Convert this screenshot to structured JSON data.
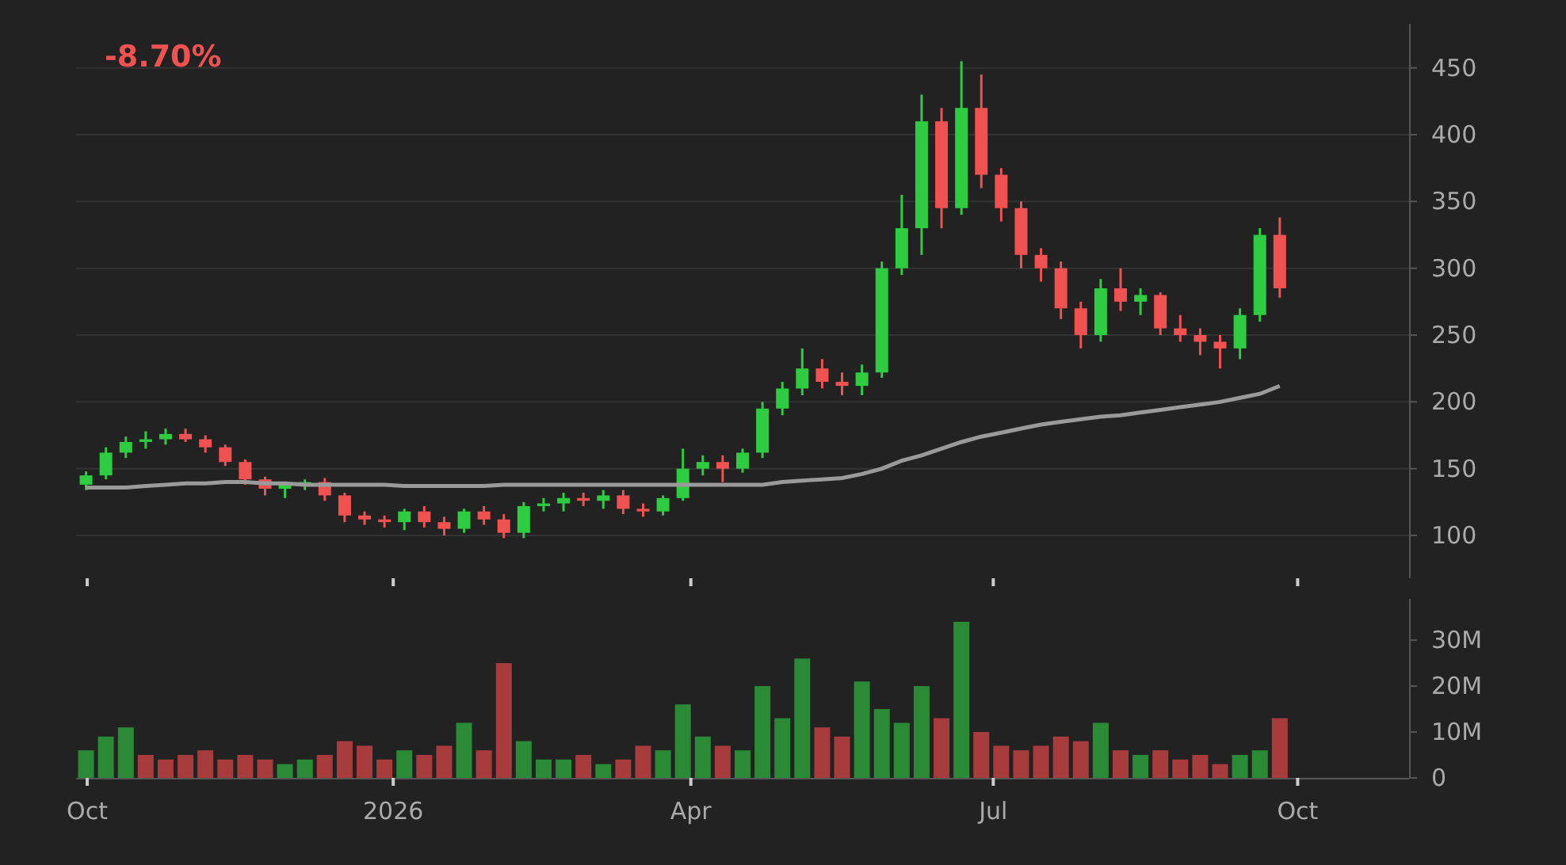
{
  "change": {
    "text": "-8.70%"
  },
  "price_panel": {
    "chart_data": {
      "type": "candlestick",
      "categories": [
        null,
        null,
        null,
        null,
        null,
        null,
        null,
        null,
        null,
        null,
        null,
        null,
        null,
        null,
        null,
        null,
        null,
        null,
        null,
        null,
        null,
        null,
        null,
        null,
        null,
        null,
        null,
        null,
        null,
        null,
        null,
        null,
        null,
        null,
        null,
        null,
        null,
        null,
        null,
        null,
        null,
        null,
        null,
        null,
        null,
        null,
        null,
        null,
        null,
        null,
        null,
        null,
        null,
        null,
        null,
        null,
        null,
        null,
        null,
        null,
        null,
        null,
        null,
        null,
        null,
        null,
        null
      ],
      "ohlc": [
        [
          138,
          148,
          134,
          145
        ],
        [
          145,
          166,
          142,
          162
        ],
        [
          162,
          174,
          158,
          170
        ],
        [
          170,
          178,
          165,
          172
        ],
        [
          172,
          180,
          168,
          176
        ],
        [
          176,
          180,
          170,
          172
        ],
        [
          172,
          175,
          162,
          166
        ],
        [
          166,
          168,
          152,
          155
        ],
        [
          155,
          157,
          138,
          142
        ],
        [
          142,
          144,
          130,
          135
        ],
        [
          135,
          140,
          128,
          138
        ],
        [
          138,
          142,
          134,
          140
        ],
        [
          140,
          143,
          126,
          130
        ],
        [
          130,
          132,
          110,
          115
        ],
        [
          115,
          118,
          108,
          112
        ],
        [
          112,
          115,
          106,
          110
        ],
        [
          110,
          120,
          104,
          118
        ],
        [
          118,
          122,
          106,
          110
        ],
        [
          110,
          114,
          100,
          105
        ],
        [
          105,
          120,
          102,
          118
        ],
        [
          118,
          122,
          108,
          112
        ],
        [
          112,
          116,
          98,
          102
        ],
        [
          102,
          125,
          98,
          122
        ],
        [
          122,
          128,
          118,
          124
        ],
        [
          124,
          132,
          118,
          128
        ],
        [
          128,
          132,
          122,
          126
        ],
        [
          126,
          134,
          120,
          130
        ],
        [
          130,
          134,
          116,
          120
        ],
        [
          120,
          124,
          114,
          118
        ],
        [
          118,
          130,
          115,
          128
        ],
        [
          128,
          165,
          126,
          150
        ],
        [
          150,
          160,
          145,
          155
        ],
        [
          155,
          160,
          140,
          150
        ],
        [
          150,
          165,
          147,
          162
        ],
        [
          162,
          200,
          158,
          195
        ],
        [
          195,
          215,
          190,
          210
        ],
        [
          210,
          240,
          205,
          225
        ],
        [
          225,
          232,
          210,
          215
        ],
        [
          215,
          222,
          205,
          212
        ],
        [
          212,
          228,
          205,
          222
        ],
        [
          222,
          305,
          218,
          300
        ],
        [
          300,
          355,
          295,
          330
        ],
        [
          330,
          430,
          310,
          410
        ],
        [
          410,
          420,
          330,
          345
        ],
        [
          345,
          455,
          340,
          420
        ],
        [
          420,
          445,
          360,
          370
        ],
        [
          370,
          375,
          335,
          345
        ],
        [
          345,
          350,
          300,
          310
        ],
        [
          310,
          315,
          290,
          300
        ],
        [
          300,
          305,
          262,
          270
        ],
        [
          270,
          275,
          240,
          250
        ],
        [
          250,
          292,
          245,
          285
        ],
        [
          285,
          300,
          268,
          275
        ],
        [
          275,
          285,
          265,
          280
        ],
        [
          280,
          282,
          250,
          255
        ],
        [
          255,
          265,
          245,
          250
        ],
        [
          250,
          255,
          235,
          245
        ],
        [
          245,
          250,
          225,
          240
        ],
        [
          240,
          270,
          232,
          265
        ],
        [
          265,
          330,
          260,
          325
        ],
        [
          325,
          338,
          278,
          285
        ],
        null,
        null,
        null,
        null,
        null,
        null
      ],
      "series": [
        {
          "type": "line",
          "color": "#9a9a9a",
          "values": [
            136,
            136,
            136,
            137,
            138,
            139,
            139,
            140,
            140,
            139,
            139,
            138,
            138,
            138,
            138,
            138,
            137,
            137,
            137,
            137,
            137,
            138,
            138,
            138,
            138,
            138,
            138,
            138,
            138,
            138,
            138,
            138,
            138,
            138,
            138,
            140,
            141,
            142,
            143,
            146,
            150,
            156,
            160,
            165,
            170,
            174,
            177,
            180,
            183,
            185,
            187,
            189,
            190,
            192,
            194,
            196,
            198,
            200,
            203,
            206,
            212,
            null,
            null,
            null,
            null,
            null,
            null
          ]
        }
      ],
      "yticks": [
        100,
        150,
        200,
        250,
        300,
        350,
        400,
        450
      ],
      "ylim": [
        68,
        483
      ],
      "grid": true
    }
  },
  "volume_panel": {
    "chart_data": {
      "type": "bar",
      "stacked": true,
      "categories": [
        null,
        null,
        null,
        null,
        null,
        null,
        null,
        null,
        null,
        null,
        null,
        null,
        null,
        null,
        null,
        null,
        null,
        null,
        null,
        null,
        null,
        null,
        null,
        null,
        null,
        null,
        null,
        null,
        null,
        null,
        null,
        null,
        null,
        null,
        null,
        null,
        null,
        null,
        null,
        null,
        null,
        null,
        null,
        null,
        null,
        null,
        null,
        null,
        null,
        null,
        null,
        null,
        null,
        null,
        null,
        null,
        null,
        null,
        null,
        null,
        null,
        null,
        null,
        null,
        null,
        null,
        null
      ],
      "series": [
        {
          "color": "#2a8a36",
          "values": [
            6,
            9,
            11,
            0,
            0,
            0,
            0,
            0,
            0,
            0,
            3,
            4,
            0,
            0,
            0,
            0,
            6,
            0,
            0,
            12,
            0,
            0,
            8,
            4,
            4,
            0,
            3,
            0,
            0,
            6,
            16,
            9,
            0,
            6,
            20,
            13,
            26,
            0,
            0,
            21,
            15,
            12,
            20,
            0,
            34,
            0,
            0,
            0,
            0,
            0,
            0,
            12,
            0,
            5,
            0,
            0,
            0,
            0,
            5,
            6,
            0,
            null,
            null,
            null,
            null,
            null,
            null
          ]
        },
        {
          "color": "#a83c3c",
          "values": [
            0,
            0,
            0,
            5,
            4,
            5,
            6,
            4,
            5,
            4,
            0,
            0,
            5,
            8,
            7,
            4,
            0,
            5,
            7,
            0,
            6,
            25,
            0,
            0,
            0,
            5,
            0,
            4,
            7,
            0,
            0,
            0,
            7,
            0,
            0,
            0,
            0,
            11,
            9,
            0,
            0,
            0,
            0,
            13,
            0,
            10,
            7,
            6,
            7,
            9,
            8,
            0,
            6,
            0,
            6,
            4,
            5,
            3,
            0,
            0,
            13,
            null,
            null,
            null,
            null,
            null,
            null
          ]
        }
      ],
      "yticks": [
        {
          "value": 0,
          "label": "0"
        },
        {
          "value": 10,
          "label": "10M"
        },
        {
          "value": 20,
          "label": "20M"
        },
        {
          "value": 30,
          "label": "30M"
        }
      ],
      "ylim": [
        0,
        39
      ]
    },
    "x_axis_labels": [
      "Oct",
      "2026",
      "Apr",
      "Jul",
      "Oct"
    ]
  }
}
